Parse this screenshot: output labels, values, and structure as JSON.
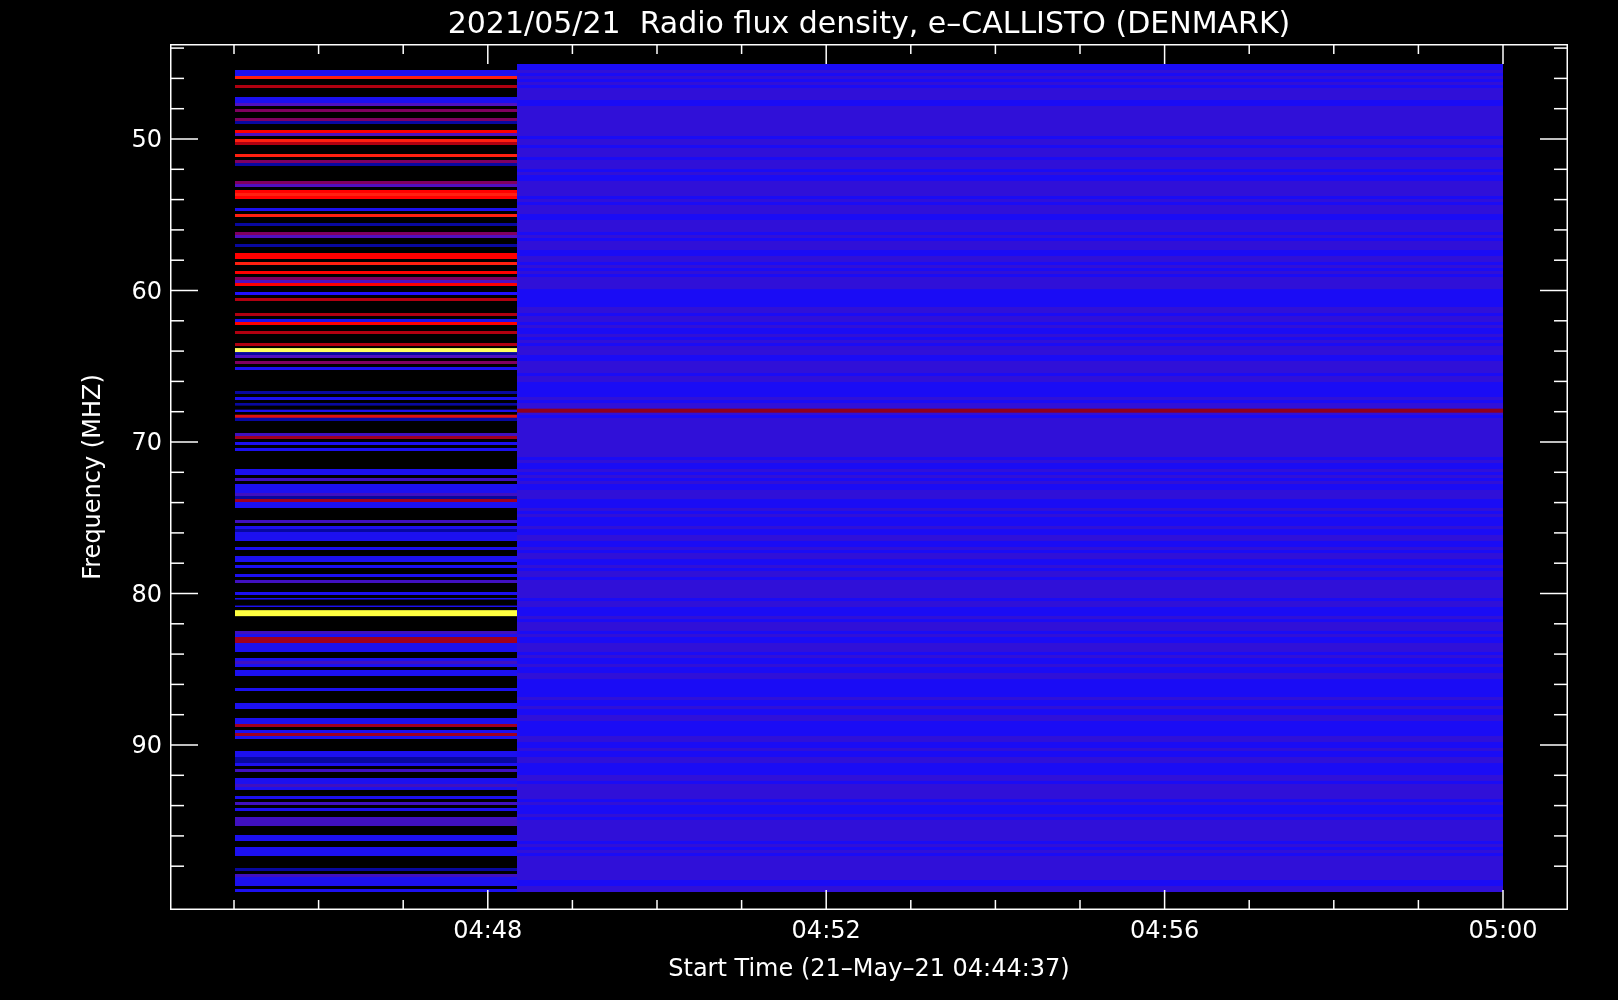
{
  "title": "2021/05/21  Radio flux density, e–CALLISTO (DENMARK)",
  "y_axis": {
    "label": "Frequency (MHZ)",
    "ticks": [
      "50",
      "60",
      "70",
      "80",
      "90"
    ]
  },
  "x_axis": {
    "label": "Start Time (21–May–21 04:44:37)",
    "ticks": [
      "04:48",
      "04:52",
      "04:56",
      "05:00"
    ]
  }
}
